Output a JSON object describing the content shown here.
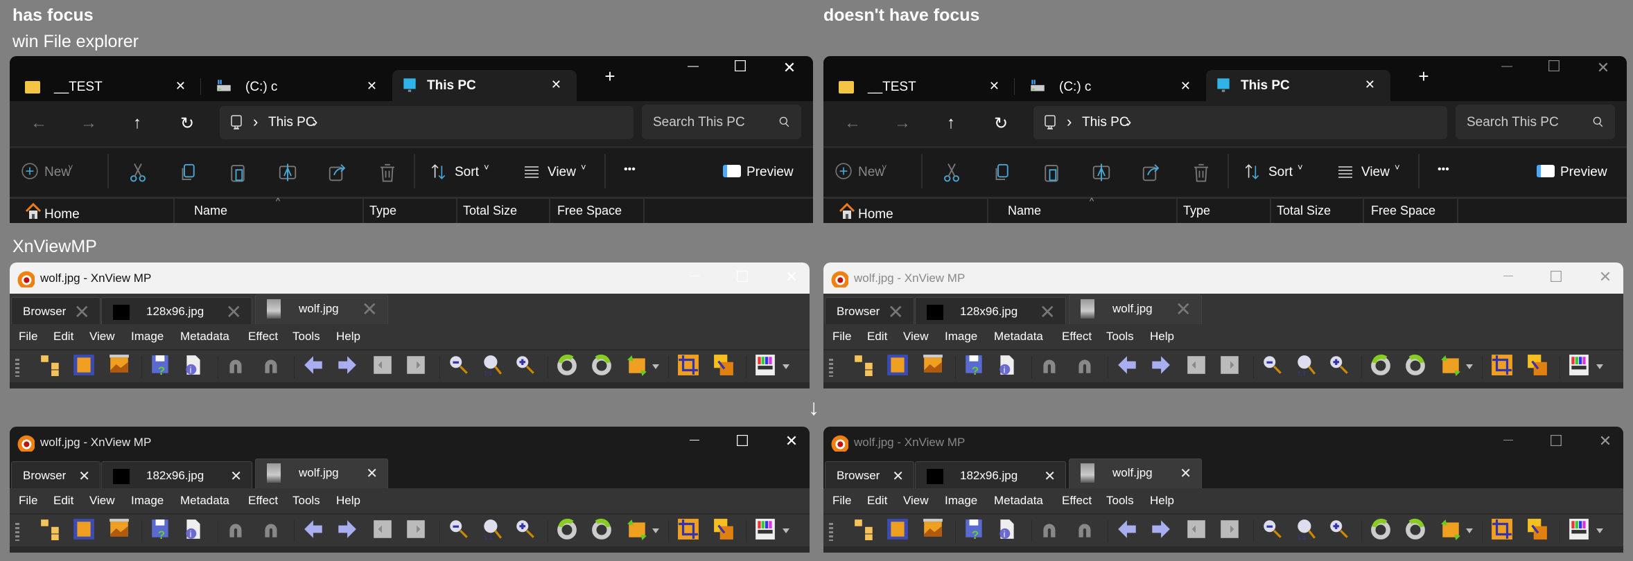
{
  "labels": {
    "has_focus": "has focus",
    "no_focus": "doesn't have focus",
    "explorer_section": "win File explorer",
    "xnview_section": "XnViewMP",
    "transition_arrow": "↓"
  },
  "explorer": {
    "tabs": [
      {
        "label": "__TEST",
        "icon": "folder-icon",
        "close": "✕"
      },
      {
        "label": "(C:) c",
        "icon": "drive-icon",
        "close": "✕"
      },
      {
        "label": "This PC",
        "icon": "monitor-icon",
        "close": "✕",
        "active": true
      }
    ],
    "new_tab": "+",
    "window_controls": {
      "minimize": "—",
      "maximize": "☐",
      "close": "✕"
    },
    "nav": {
      "back": "←",
      "forward": "→",
      "up": "↑",
      "refresh": "↻"
    },
    "address": {
      "segment": "This PC",
      "chevron": "›"
    },
    "search_placeholder": "Search This PC",
    "commands": {
      "new": "New",
      "sort": "Sort",
      "view": "View",
      "more": "•••",
      "preview": "Preview",
      "dropdown": "˅"
    },
    "sidebar_item": "Home",
    "sort_indicator": "^",
    "columns": [
      "Name",
      "Type",
      "Total Size",
      "Free Space"
    ]
  },
  "xnview": {
    "windows": [
      {
        "title": "wolf.jpg - XnView MP",
        "theme": "light",
        "tabs": [
          {
            "label": "Browser",
            "thumb": "none"
          },
          {
            "label": "128x96.jpg",
            "thumb": "black"
          },
          {
            "label": "wolf.jpg",
            "thumb": "wolf",
            "active": true
          }
        ],
        "close": "✕"
      },
      {
        "title": "wolf.jpg - XnView MP",
        "theme": "dark",
        "tabs": [
          {
            "label": "Browser",
            "thumb": "none"
          },
          {
            "label": "182x96.jpg",
            "thumb": "black"
          },
          {
            "label": "wolf.jpg",
            "thumb": "wolf",
            "active": true
          }
        ],
        "close": "✕"
      }
    ],
    "window_controls": {
      "minimize": "—",
      "maximize": "☐",
      "close": "✕"
    },
    "menu": [
      "File",
      "Edit",
      "View",
      "Image",
      "Metadata",
      "Effect",
      "Tools",
      "Help"
    ],
    "toolbar": [
      "browser-folders-icon",
      "fullscreen-icon",
      "slideshow-icon",
      "save-icon",
      "properties-icon",
      "undo-icon",
      "redo-icon",
      "previous-icon",
      "next-icon",
      "previous-page-icon",
      "next-page-icon",
      "zoom-out-icon",
      "actual-size-icon",
      "zoom-in-icon",
      "rotate-left-icon",
      "rotate-right-icon",
      "auto-rotate-icon",
      "crop-icon",
      "resize-icon",
      "color-adjust-icon"
    ]
  },
  "colors": {
    "background": "#808080",
    "explorer_bg": "#1c1c1c",
    "xnview_bg": "#353535",
    "accent": "#4cc2ff"
  }
}
